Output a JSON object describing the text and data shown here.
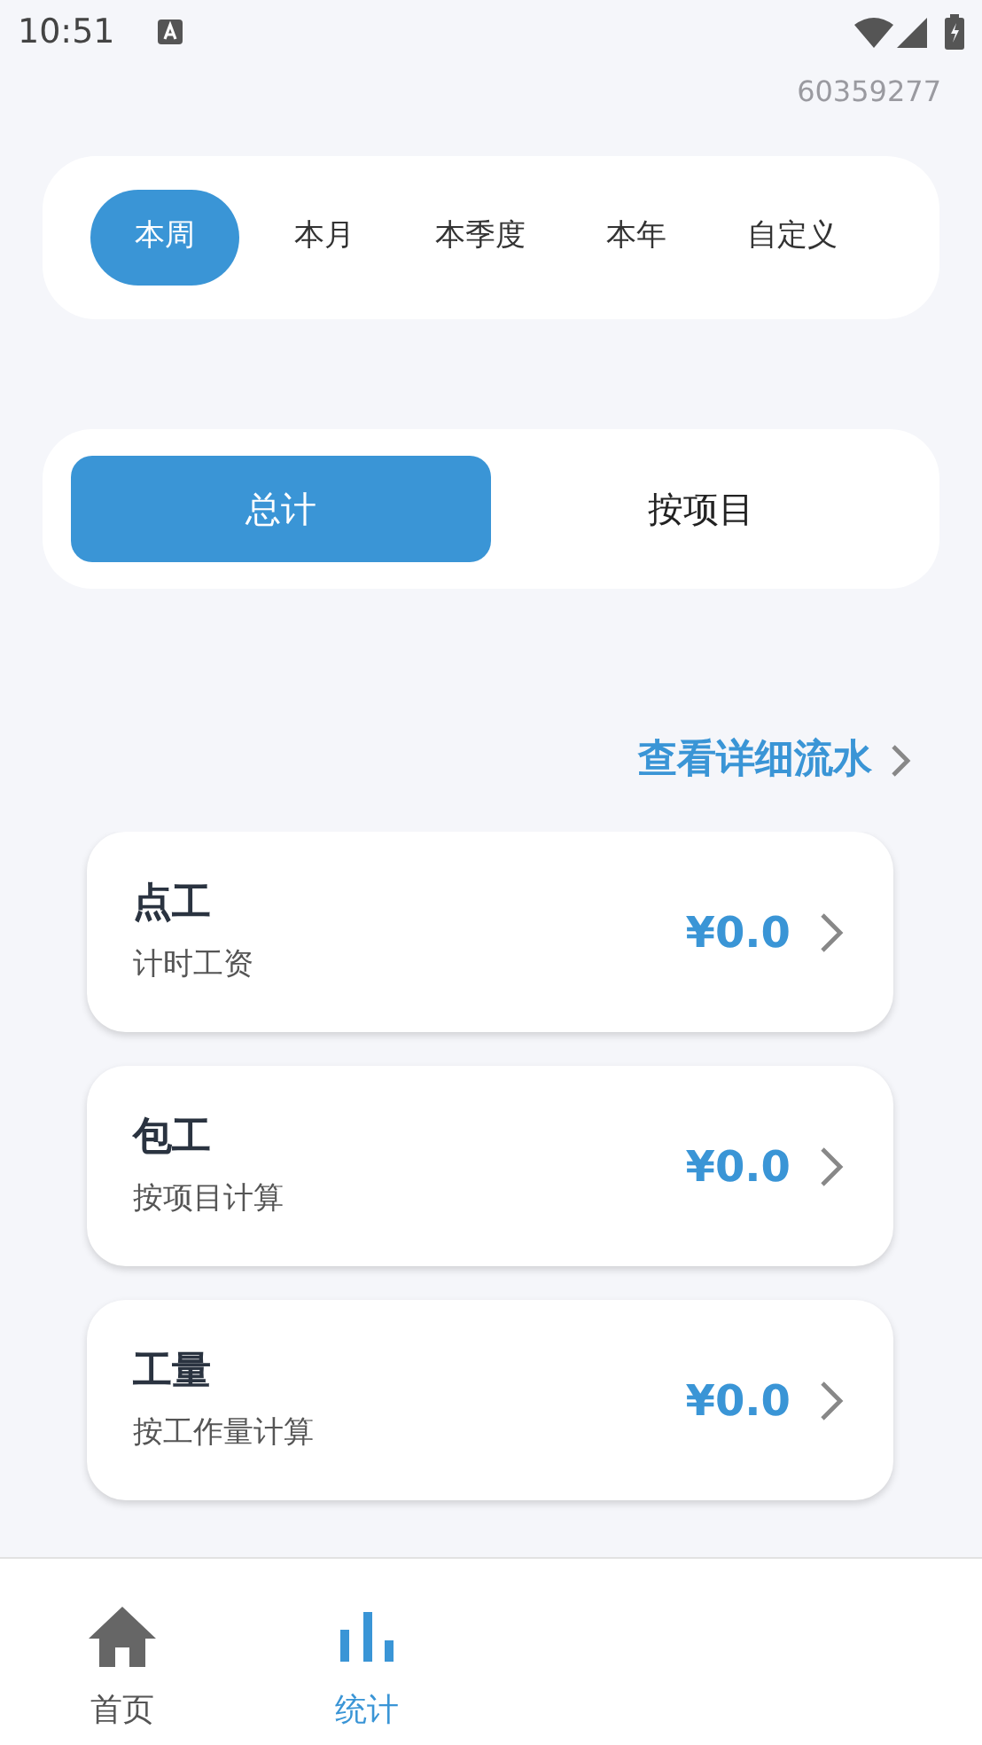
{
  "status_bar": {
    "time": "10:51"
  },
  "account_id": "60359277",
  "periods": [
    {
      "label": "本周",
      "selected": true
    },
    {
      "label": "本月",
      "selected": false
    },
    {
      "label": "本季度",
      "selected": false
    },
    {
      "label": "本年",
      "selected": false
    },
    {
      "label": "自定义",
      "selected": false
    }
  ],
  "view_toggle": [
    {
      "label": "总计",
      "selected": true
    },
    {
      "label": "按项目",
      "selected": false
    }
  ],
  "detail_link": "查看详细流水",
  "categories": [
    {
      "title": "点工",
      "subtitle": "计时工资",
      "amount": "¥0.0"
    },
    {
      "title": "包工",
      "subtitle": "按项目计算",
      "amount": "¥0.0"
    },
    {
      "title": "工量",
      "subtitle": "按工作量计算",
      "amount": "¥0.0"
    }
  ],
  "bottom_nav": [
    {
      "label": "首页",
      "kind": "home",
      "selected": false
    },
    {
      "label": "统计",
      "kind": "stats",
      "selected": true
    }
  ]
}
